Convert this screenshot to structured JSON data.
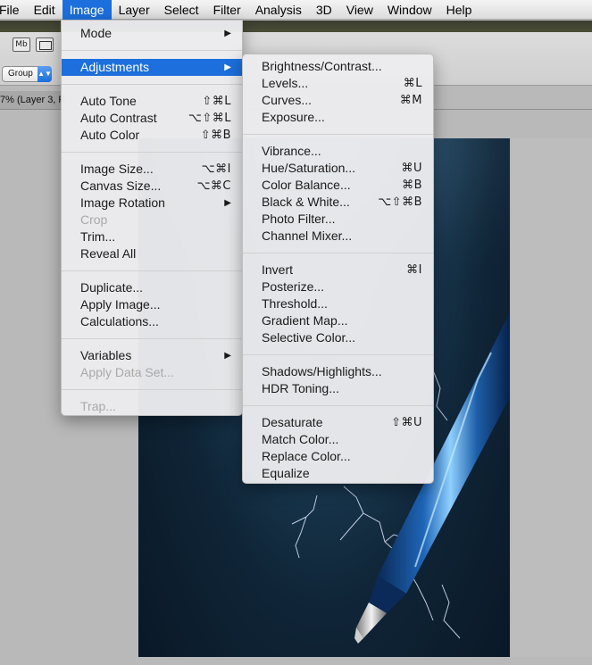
{
  "menubar": {
    "items": [
      "File",
      "Edit",
      "Image",
      "Layer",
      "Select",
      "Filter",
      "Analysis",
      "3D",
      "View",
      "Window",
      "Help"
    ],
    "active": "Image"
  },
  "options_bar": {
    "mb_icon_label": "Mb",
    "group_select_value": "Group"
  },
  "document": {
    "tab_text": "7% (Layer 3, R"
  },
  "image_menu": {
    "items": [
      {
        "label": "Mode",
        "shortcut": "",
        "submenu": true,
        "disabled": false
      },
      {
        "separator": true
      },
      {
        "label": "Adjustments",
        "shortcut": "",
        "submenu": true,
        "highlighted": true
      },
      {
        "separator": true
      },
      {
        "label": "Auto Tone",
        "shortcut": "⇧⌘L"
      },
      {
        "label": "Auto Contrast",
        "shortcut": "⌥⇧⌘L"
      },
      {
        "label": "Auto Color",
        "shortcut": "⇧⌘B"
      },
      {
        "separator": true
      },
      {
        "label": "Image Size...",
        "shortcut": "⌥⌘I"
      },
      {
        "label": "Canvas Size...",
        "shortcut": "⌥⌘C"
      },
      {
        "label": "Image Rotation",
        "shortcut": "",
        "submenu": true
      },
      {
        "label": "Crop",
        "shortcut": "",
        "disabled": true
      },
      {
        "label": "Trim...",
        "shortcut": ""
      },
      {
        "label": "Reveal All",
        "shortcut": ""
      },
      {
        "separator": true
      },
      {
        "label": "Duplicate...",
        "shortcut": ""
      },
      {
        "label": "Apply Image...",
        "shortcut": ""
      },
      {
        "label": "Calculations...",
        "shortcut": ""
      },
      {
        "separator": true
      },
      {
        "label": "Variables",
        "shortcut": "",
        "submenu": true
      },
      {
        "label": "Apply Data Set...",
        "shortcut": "",
        "disabled": true
      },
      {
        "separator": true
      },
      {
        "label": "Trap...",
        "shortcut": "",
        "disabled": true
      }
    ]
  },
  "adjustments_menu": {
    "items": [
      {
        "label": "Brightness/Contrast...",
        "shortcut": ""
      },
      {
        "label": "Levels...",
        "shortcut": "⌘L"
      },
      {
        "label": "Curves...",
        "shortcut": "⌘M"
      },
      {
        "label": "Exposure...",
        "shortcut": ""
      },
      {
        "separator": true
      },
      {
        "label": "Vibrance...",
        "shortcut": ""
      },
      {
        "label": "Hue/Saturation...",
        "shortcut": "⌘U"
      },
      {
        "label": "Color Balance...",
        "shortcut": "⌘B"
      },
      {
        "label": "Black & White...",
        "shortcut": "⌥⇧⌘B"
      },
      {
        "label": "Photo Filter...",
        "shortcut": ""
      },
      {
        "label": "Channel Mixer...",
        "shortcut": ""
      },
      {
        "separator": true
      },
      {
        "label": "Invert",
        "shortcut": "⌘I"
      },
      {
        "label": "Posterize...",
        "shortcut": ""
      },
      {
        "label": "Threshold...",
        "shortcut": ""
      },
      {
        "label": "Gradient Map...",
        "shortcut": ""
      },
      {
        "label": "Selective Color...",
        "shortcut": ""
      },
      {
        "separator": true
      },
      {
        "label": "Shadows/Highlights...",
        "shortcut": ""
      },
      {
        "label": "HDR Toning...",
        "shortcut": ""
      },
      {
        "separator": true
      },
      {
        "label": "Desaturate",
        "shortcut": "⇧⌘U"
      },
      {
        "label": "Match Color...",
        "shortcut": ""
      },
      {
        "label": "Replace Color...",
        "shortcut": ""
      },
      {
        "label": "Equalize",
        "shortcut": ""
      }
    ]
  },
  "colors": {
    "highlight": "#1c6fdc",
    "menu_bg": "#ececee",
    "disabled_text": "#a9a9a9"
  }
}
